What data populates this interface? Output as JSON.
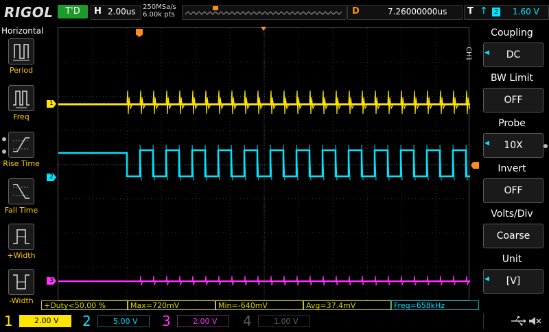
{
  "header": {
    "brand": "RIGOL",
    "run_status": "T'D",
    "horizontal_label": "H",
    "timebase": "2.00us",
    "sample_rate": "250MSa/s",
    "memory_depth": "6.00k pts",
    "trigger_position_label": "D",
    "trigger_position": "7.26000000us",
    "trigger_label": "T",
    "trigger_source": "2",
    "trigger_level": "1.60 V"
  },
  "left_menu": {
    "title": "Horizontal",
    "items": [
      {
        "label": "Period",
        "icon": "period-icon"
      },
      {
        "label": "Freq",
        "icon": "freq-icon"
      },
      {
        "label": "Rise Time",
        "icon": "rise-time-icon"
      },
      {
        "label": "Fall Time",
        "icon": "fall-time-icon"
      },
      {
        "label": "+Width",
        "icon": "positive-width-icon"
      },
      {
        "label": "-Width",
        "icon": "negative-width-icon"
      }
    ]
  },
  "right_menu": {
    "channel_tag": "CH1",
    "items": [
      {
        "title": "Coupling",
        "value": "DC",
        "has_arrow": true
      },
      {
        "title": "BW Limit",
        "value": "OFF",
        "has_arrow": false
      },
      {
        "title": "Probe",
        "value": "10X",
        "has_arrow": true
      },
      {
        "title": "Invert",
        "value": "OFF",
        "has_arrow": false
      },
      {
        "title": "Volts/Div",
        "value": "Coarse",
        "has_arrow": false
      },
      {
        "title": "Unit",
        "value": "[V]",
        "has_arrow": true
      }
    ]
  },
  "measurements": [
    {
      "text": "+Duty<50.00 %",
      "color": "#d8d800"
    },
    {
      "text": "Max=720mV",
      "color": "#d8d800"
    },
    {
      "text": "Min=-640mV",
      "color": "#d8d800"
    },
    {
      "text": "Avg=37.4mV",
      "color": "#d8d800"
    },
    {
      "text": "Freq=658kHz",
      "color": "#00e5ff"
    }
  ],
  "channels": [
    {
      "num": "1",
      "scale": "2.00 V",
      "color": "#ffe600",
      "active": true
    },
    {
      "num": "2",
      "scale": "5.00 V",
      "color": "#00e5ff",
      "active": false
    },
    {
      "num": "3",
      "scale": "2.00 V",
      "color": "#ff33ff",
      "active": false
    },
    {
      "num": "4",
      "scale": "1.00 V",
      "color": "#5a5a5a",
      "active": false
    }
  ],
  "trace_markers": {
    "ch1": "1",
    "ch2": "2",
    "ch3": "3"
  },
  "colors": {
    "ch1": "#ffe600",
    "ch2": "#00e5ff",
    "ch3": "#ff33ff",
    "trigger": "#ff8c1a",
    "run": "#1a9b2a"
  },
  "status_icons": [
    "usb-icon",
    "speaker-muted-icon"
  ]
}
